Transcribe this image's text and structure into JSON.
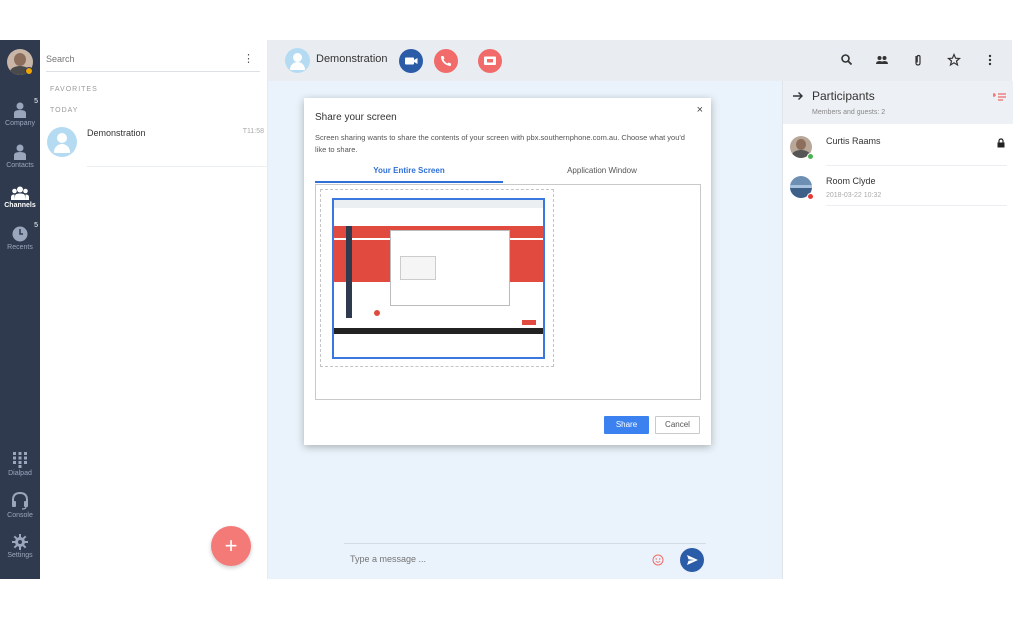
{
  "nav": {
    "items": [
      {
        "label": "Company",
        "badge": "5"
      },
      {
        "label": "Contacts",
        "badge": ""
      },
      {
        "label": "Channels",
        "badge": ""
      },
      {
        "label": "Recents",
        "badge": "5"
      },
      {
        "label": "Dialpad",
        "badge": ""
      },
      {
        "label": "Console",
        "badge": ""
      },
      {
        "label": "Settings",
        "badge": ""
      }
    ]
  },
  "convlist": {
    "search_placeholder": "Search",
    "favorites_label": "FAVORITES",
    "today_label": "TODAY",
    "conversation": {
      "name": "Demonstration",
      "time": "T11:58"
    },
    "fab_label": "+"
  },
  "header": {
    "title": "Demonstration"
  },
  "composer": {
    "placeholder": "Type a message ..."
  },
  "participants": {
    "title": "Participants",
    "subtitle": "Members and guests: 2",
    "people": [
      {
        "name": "Curtis Raams",
        "date": ""
      },
      {
        "name": "Room Clyde",
        "date": "2018-03-22 10:32"
      }
    ]
  },
  "dialog": {
    "title": "Share your screen",
    "description": "Screen sharing wants to share the contents of your screen with pbx.southernphone.com.au. Choose what you'd like to share.",
    "tabs": [
      "Your Entire Screen",
      "Application Window"
    ],
    "close_label": "×",
    "share_label": "Share",
    "cancel_label": "Cancel"
  },
  "colors": {
    "rail": "#2f3a4f",
    "accent_blue": "#2b5ca8",
    "accent_red": "#f06b6a",
    "panel_header": "#edf0f4"
  },
  "icons": [
    "video-call-icon",
    "phone-icon",
    "end-call-icon",
    "search-icon",
    "people-icon",
    "attachment-icon",
    "star-icon",
    "more-icon",
    "send-icon",
    "emoji-icon",
    "arrow-right-icon",
    "add-participant-icon",
    "lock-icon"
  ]
}
